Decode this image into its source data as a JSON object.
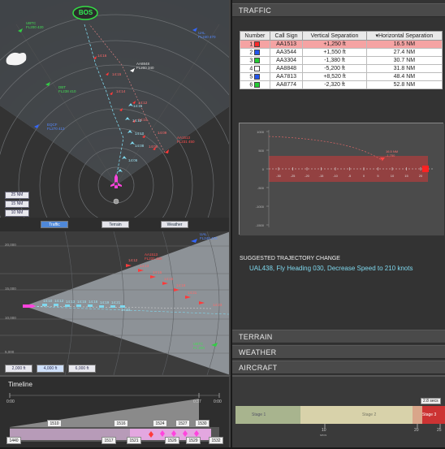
{
  "plan_view": {
    "airport_label": "BOS",
    "aircraft_tags": {
      "own": [
        "AA8848",
        "FL200 340"
      ],
      "tl1": [
        "UBTC",
        "FL200 420"
      ],
      "tl2": [
        "DBT",
        "FL238 410"
      ],
      "tl3": [
        "EQCF",
        "FL270 413"
      ],
      "tr1": [
        "UAL",
        "FL240 470"
      ],
      "r1": [
        "AA1513",
        "FL231 450"
      ],
      "tr3": [
        "DDA",
        "FL230 410"
      ]
    },
    "trail_labels": [
      "14:15",
      "14:13",
      "14:12",
      "14:11",
      "14:10",
      "14:09",
      "14:08",
      "14:07",
      "14:06",
      "14:05"
    ],
    "conflict_trail_labels": [
      "14:16",
      "14:15",
      "14:14",
      "14:12",
      "14:10",
      "14:09",
      "14:08"
    ],
    "range_buttons": [
      "25 NM",
      "15 NM",
      "10 NM"
    ]
  },
  "view_tabs": {
    "traffic": "Traffic",
    "terrain": "Terrain",
    "weather": "Weather"
  },
  "vertical_view": {
    "altitude_labels": [
      "20,000",
      "15,000",
      "10,000",
      "5,000"
    ],
    "trail_labels": [
      "14:10",
      "14:12",
      "14:13",
      "14:15",
      "14:16",
      "14:19",
      "14:21",
      "14:23"
    ],
    "conflict_labels": [
      "14:12",
      "14:13",
      "14:15",
      "14:16",
      "14:19",
      "14:21",
      "14:23"
    ],
    "tags": {
      "top_right": [
        "UAL",
        "FL240 470"
      ],
      "mid": [
        "AA1513",
        "FL231 450"
      ],
      "bottom_right": [
        "UBTC",
        "FL 200"
      ]
    },
    "altitude_buttons": [
      "2,000 ft",
      "4,000 ft",
      "6,000 ft"
    ]
  },
  "timeline": {
    "title": "Timeline",
    "top_ticks": [
      "0:00",
      "0:37",
      "0:00"
    ],
    "time_boxes": [
      "1440",
      "1510",
      "1516",
      "1517",
      "1521",
      "1524",
      "1526",
      "1527",
      "1529",
      "1530",
      "1532"
    ]
  },
  "traffic": {
    "header": "TRAFFIC",
    "columns": [
      "Number",
      "Call Sign",
      "Vertical Separation",
      "▾Horizontal Separation"
    ],
    "rows": [
      {
        "num": "1",
        "color": "#ff2a2a",
        "call": "AA1513",
        "vsep": "+1,250 ft",
        "hsep": "16.5 NM"
      },
      {
        "num": "2",
        "color": "#2255ee",
        "call": "AA3544",
        "vsep": "+1,550 ft",
        "hsep": "27.4 NM"
      },
      {
        "num": "3",
        "color": "#22cc33",
        "call": "AA3304",
        "vsep": "-1,380 ft",
        "hsep": "30.7 NM"
      },
      {
        "num": "4",
        "color": "#ffffff",
        "call": "AA8848",
        "vsep": "-5,200 ft",
        "hsep": "31.8 NM"
      },
      {
        "num": "5",
        "color": "#2255ee",
        "call": "AA7813",
        "vsep": "+8,520 ft",
        "hsep": "48.4 NM"
      },
      {
        "num": "6",
        "color": "#22cc33",
        "call": "AA8774",
        "vsep": "-2,320 ft",
        "hsep": "52.8 NM"
      }
    ]
  },
  "separation_chart": {
    "y_ticks": [
      "1000",
      "500",
      "0",
      "-500",
      "-1000",
      "-1500"
    ],
    "x_ticks": [
      "-30",
      "-25",
      "-20",
      "-15",
      "-10",
      "-5",
      "0",
      "5",
      "10",
      "15",
      "20"
    ],
    "marker_labels": [
      "16.5 NM",
      "-1,750"
    ]
  },
  "suggestion": {
    "title": "SUGGESTED TRAJECTORY CHANGE",
    "text": "UAL438, Fly Heading 030, Decrease Speed to 210 knots"
  },
  "accordion": {
    "terrain": "TERRAIN",
    "weather": "WEATHER",
    "aircraft": "AIRCRAFT"
  },
  "phase_bar": {
    "tooltip": "2.8 secs",
    "stage_labels": [
      "Stage 1",
      "Stage 2",
      "Stage 3"
    ],
    "ticks": [
      "10",
      "20",
      "25"
    ],
    "tick_unit": "secs"
  },
  "colors": {
    "conflict": "#ff3030",
    "own_ship": "#ff44dd",
    "trail": "#7fd8ee",
    "accent_blue": "#4f88d8"
  }
}
